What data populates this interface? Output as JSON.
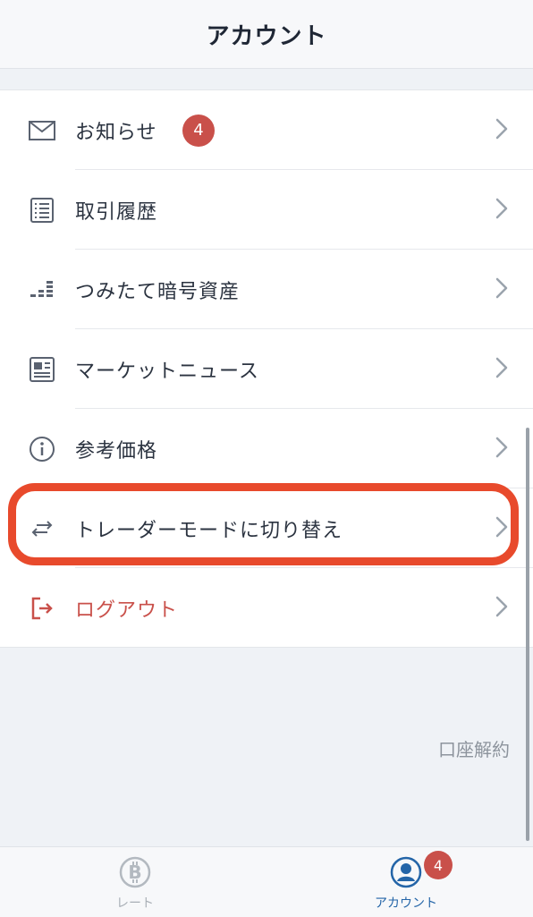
{
  "header": {
    "title": "アカウント"
  },
  "menu": {
    "items": [
      {
        "label": "お知らせ",
        "icon": "mail-icon",
        "badge": "4"
      },
      {
        "label": "取引履歴",
        "icon": "list-icon"
      },
      {
        "label": "つみたて暗号資産",
        "icon": "accumulation-icon"
      },
      {
        "label": "マーケットニュース",
        "icon": "news-icon"
      },
      {
        "label": "参考価格",
        "icon": "info-icon"
      },
      {
        "label": "トレーダーモードに切り替え",
        "icon": "swap-icon"
      },
      {
        "label": "ログアウト",
        "icon": "logout-icon"
      }
    ]
  },
  "footer": {
    "close_account": "口座解約"
  },
  "tabbar": {
    "tabs": [
      {
        "label": "レート",
        "icon": "bitcoin-icon",
        "active": false
      },
      {
        "label": "アカウント",
        "icon": "user-icon",
        "active": true,
        "badge": "4"
      }
    ]
  },
  "colors": {
    "accent": "#2465a8",
    "badge": "#c9504a",
    "logout": "#c9504a",
    "highlight": "#e84a2c",
    "background": "#eff2f6"
  }
}
